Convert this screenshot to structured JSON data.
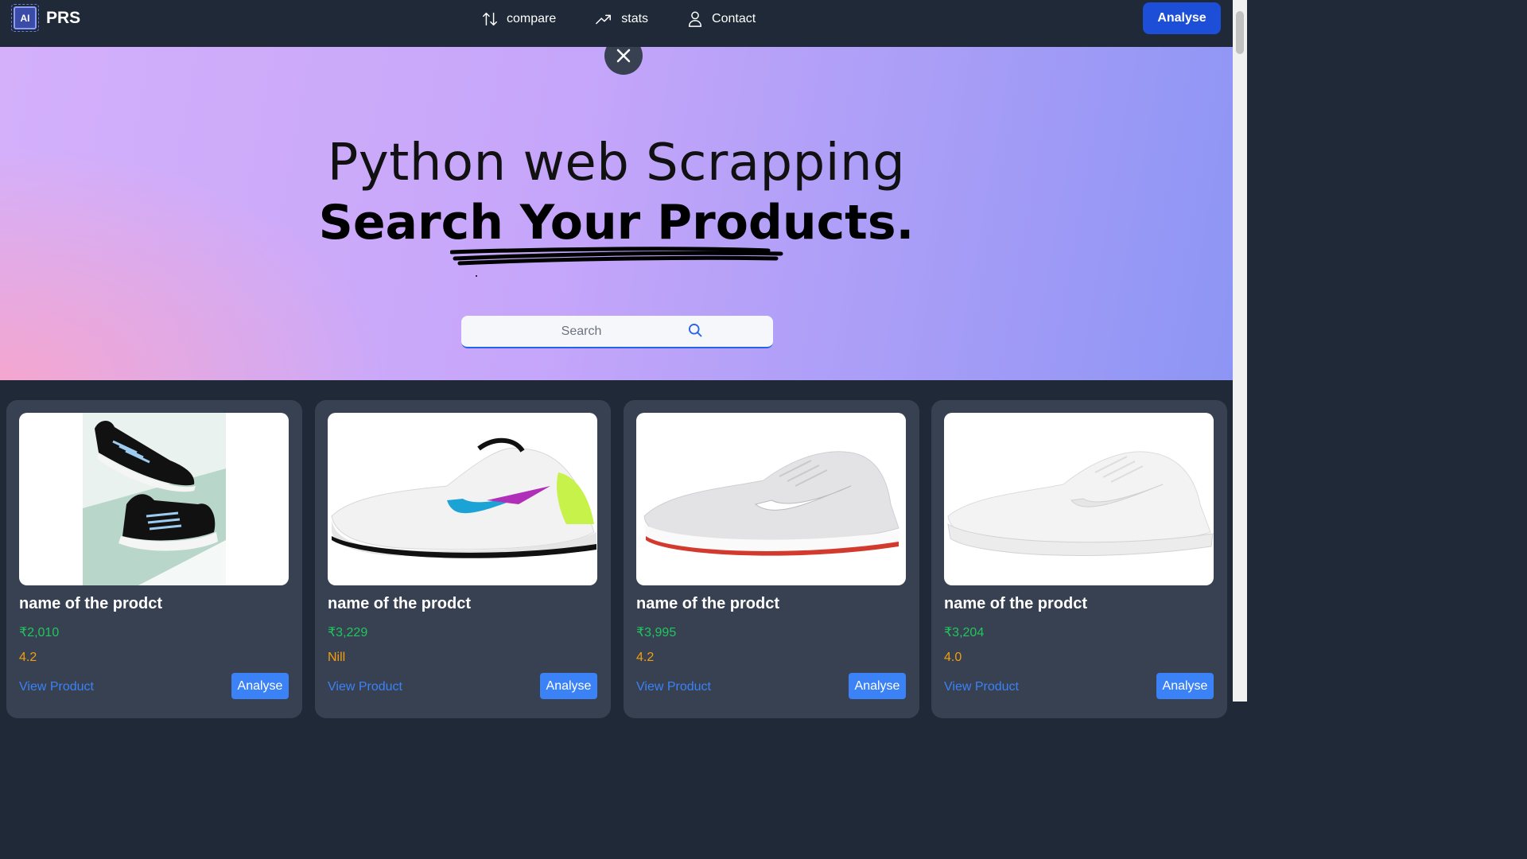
{
  "navbar": {
    "logo_text": "AI",
    "brand": "PRS",
    "links": [
      {
        "label": "compare",
        "icon": "arrows-up-down-icon"
      },
      {
        "label": "stats",
        "icon": "trending-up-icon"
      },
      {
        "label": "Contact",
        "icon": "user-icon"
      }
    ],
    "analyse_label": "Analyse"
  },
  "hero": {
    "line1": "Python web Scrapping",
    "line2": "Search Your Products.",
    "search_placeholder": "Search"
  },
  "products": [
    {
      "name": "name of the prodct",
      "price": "₹2,010",
      "rating": "4.2",
      "view_label": "View Product",
      "analyse_label": "Analyse"
    },
    {
      "name": "name of the prodct",
      "price": "₹3,229",
      "rating": "Nill",
      "view_label": "View Product",
      "analyse_label": "Analyse"
    },
    {
      "name": "name of the prodct",
      "price": "₹3,995",
      "rating": "4.2",
      "view_label": "View Product",
      "analyse_label": "Analyse"
    },
    {
      "name": "name of the prodct",
      "price": "₹3,204",
      "rating": "4.0",
      "view_label": "View Product",
      "analyse_label": "Analyse"
    }
  ],
  "colors": {
    "nav_bg": "#1f2937",
    "accent": "#1d4ed8",
    "button": "#3b82f6",
    "price": "#22c55e",
    "rating": "#f59e0b",
    "card_bg": "#374151"
  }
}
